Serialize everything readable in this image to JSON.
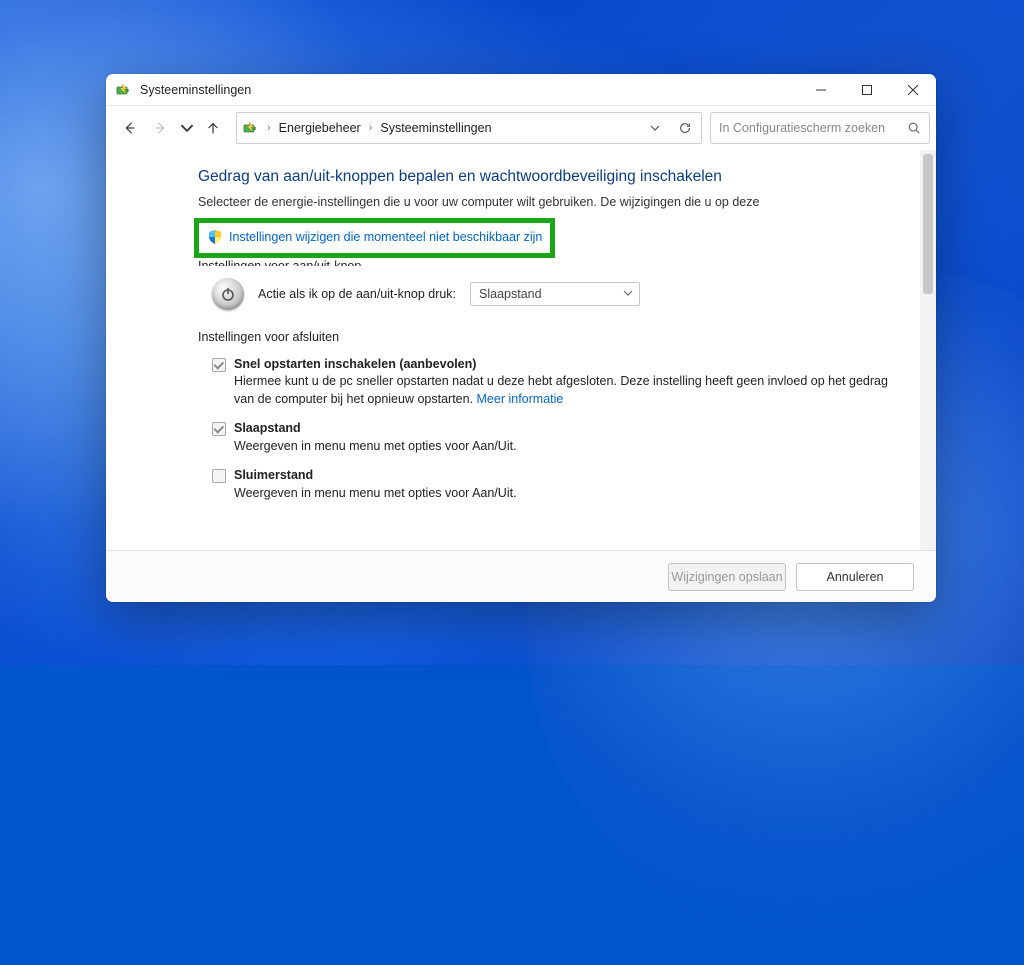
{
  "window": {
    "title": "Systeeminstellingen"
  },
  "toolbar": {
    "breadcrumb": {
      "item1": "Energiebeheer",
      "item2": "Systeeminstellingen"
    },
    "search_placeholder": "In Configuratiescherm zoeken"
  },
  "page": {
    "heading": "Gedrag van aan/uit-knoppen bepalen en wachtwoordbeveiliging inschakelen",
    "description": "Selecteer de energie-instellingen die u voor uw computer wilt gebruiken. De wijzigingen die u op deze",
    "admin_link": "Instellingen wijzigen die momenteel niet beschikbaar zijn",
    "clipped_section_label": "Instellingen voor aan/uit-knop",
    "power_button": {
      "label": "Actie als ik op de aan/uit-knop druk:",
      "value": "Slaapstand"
    },
    "shutdown_section": "Instellingen voor afsluiten",
    "checks": {
      "fast_startup": {
        "title": "Snel opstarten inschakelen (aanbevolen)",
        "desc": "Hiermee kunt u de pc sneller opstarten nadat u deze hebt afgesloten. Deze instelling heeft geen invloed op het gedrag van de computer bij het opnieuw opstarten. ",
        "more": "Meer informatie"
      },
      "sleep": {
        "title": "Slaapstand",
        "desc": "Weergeven in menu menu met opties voor Aan/Uit."
      },
      "hibernate": {
        "title": "Sluimerstand",
        "desc": "Weergeven in menu menu met opties voor Aan/Uit."
      }
    }
  },
  "footer": {
    "save": "Wijzigingen opslaan",
    "cancel": "Annuleren"
  }
}
